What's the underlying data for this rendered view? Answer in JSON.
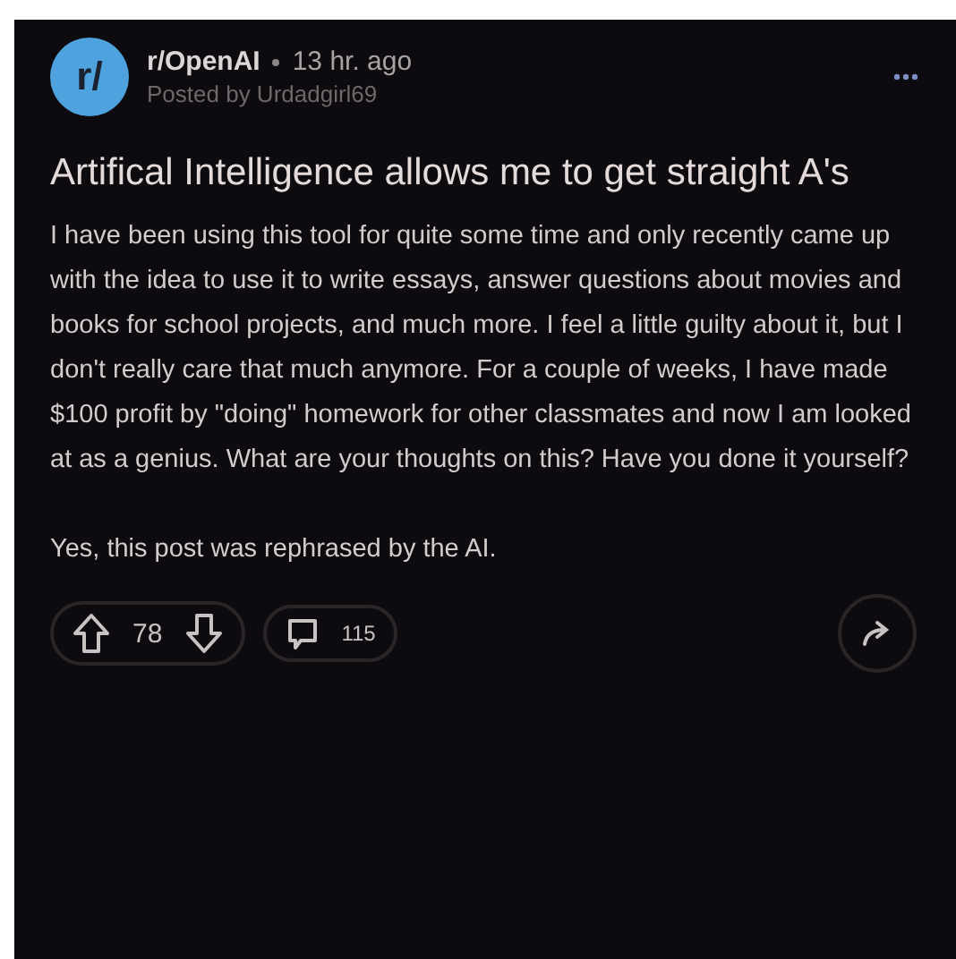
{
  "post": {
    "subreddit": "r/OpenAI",
    "time": "13 hr. ago",
    "author_line": "Posted by Urdadgirl69",
    "avatar_text": "r/",
    "title": "Artifical Intelligence allows me to get straight A's",
    "body": "I have been using this tool for quite some time and only recently came up with the idea to use it to write essays, answer questions about movies and books for school projects, and much more. I feel a little guilty about it, but I don't really care that much anymore. For a couple of weeks, I have made $100 profit by \"doing\" homework for other classmates and now I am looked at as a genius. What are your thoughts on this? Have you done it yourself?",
    "note": "Yes, this post was rephrased by the AI.",
    "votes": "78",
    "comments": "115"
  }
}
